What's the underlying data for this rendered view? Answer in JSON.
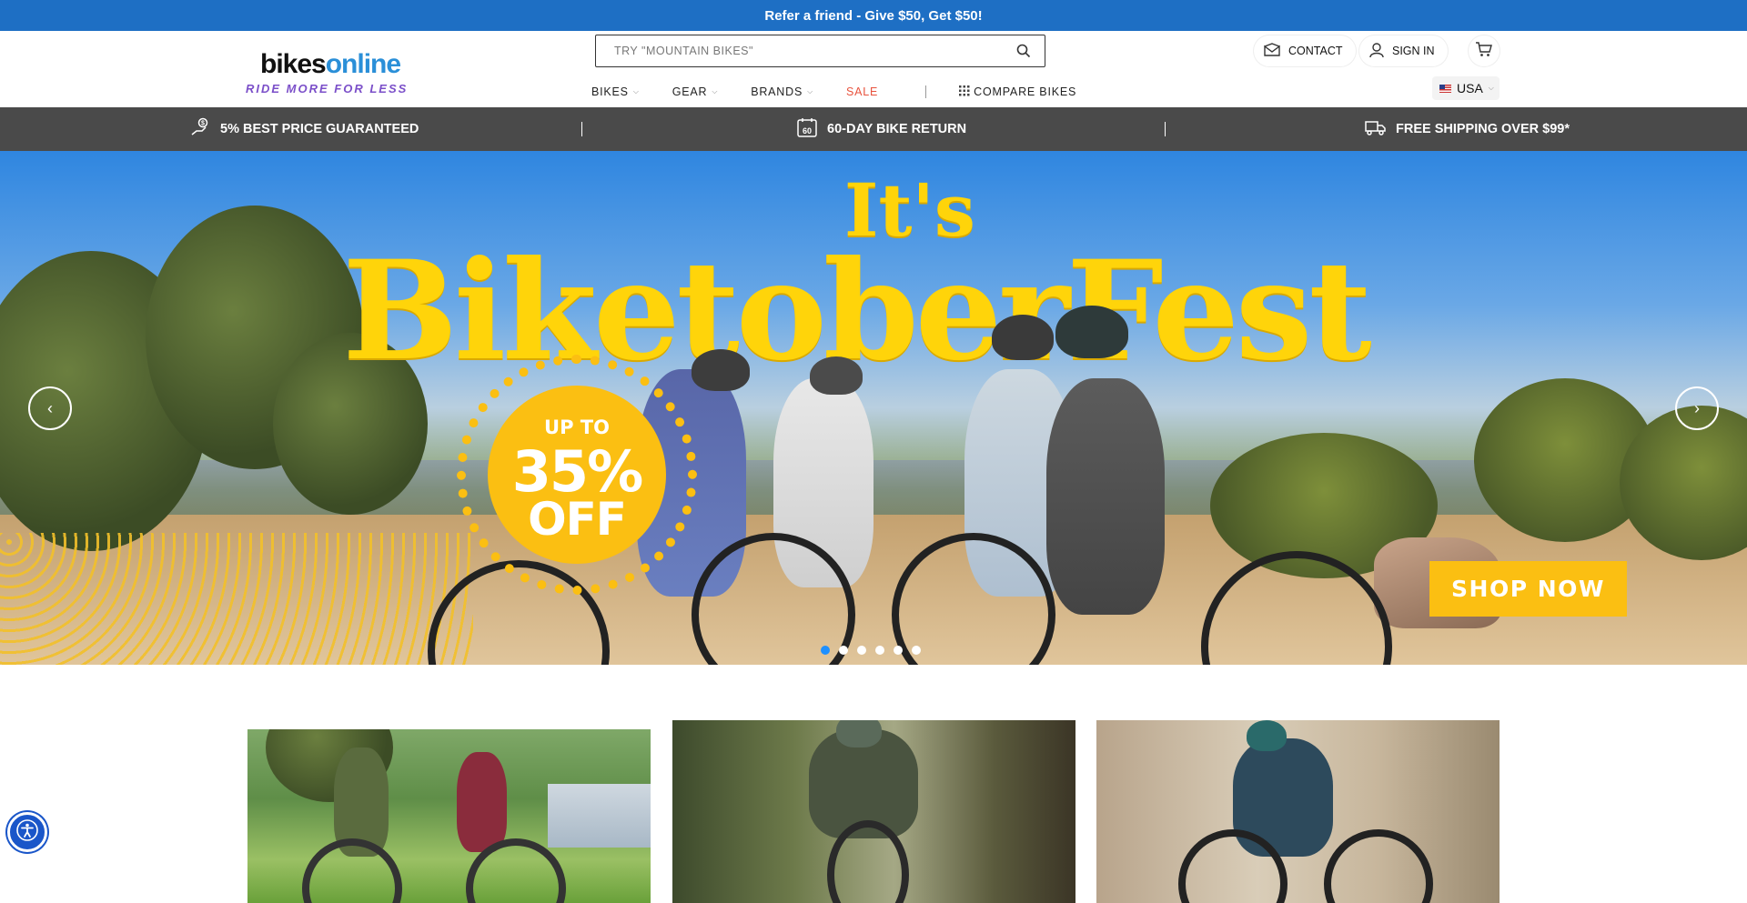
{
  "announcement": {
    "text": "Refer a friend - Give $50, Get $50!"
  },
  "header": {
    "logo": {
      "brand_part1": "bikes",
      "brand_part2": "online",
      "tagline": "RIDE MORE FOR LESS"
    },
    "search": {
      "placeholder": "TRY \"MOUNTAIN BIKES\"",
      "icon": "search-icon"
    },
    "contact_label": "CONTACT",
    "signin_label": "SIGN IN",
    "cart_icon": "cart-icon",
    "nav": {
      "bikes": "BIKES",
      "gear": "GEAR",
      "brands": "BRANDS",
      "sale": "SALE",
      "compare": "COMPARE BIKES"
    },
    "country": {
      "label": "USA",
      "flag_icon": "us-flag-icon"
    }
  },
  "usp_bar": {
    "items": [
      {
        "label": "5% BEST PRICE GUARANTEED",
        "icon": "price-tag-hand-icon"
      },
      {
        "label": "60-DAY BIKE RETURN",
        "icon": "calendar-60-icon",
        "icon_text": "60"
      },
      {
        "label": "FREE SHIPPING OVER $99*",
        "icon": "delivery-truck-icon"
      }
    ]
  },
  "hero": {
    "headline_small": "It's",
    "headline_big": "BiketoberFest",
    "badge": {
      "line1": "UP TO",
      "line2": "35%",
      "line3": "OFF"
    },
    "cta_label": "SHOP NOW",
    "slides_total": 6,
    "active_slide": 1,
    "colors": {
      "headline": "#ffd40a",
      "badge": "#fbbf12",
      "cta": "#fbbf12",
      "active_dot": "#1e90ff"
    }
  },
  "colors": {
    "announcement_bg": "#1e6fc4",
    "usp_bg": "#4a4a4a",
    "sale": "#e8533e",
    "accessibility_button": "#1a56c9"
  },
  "accessibility": {
    "icon": "accessibility-icon"
  }
}
